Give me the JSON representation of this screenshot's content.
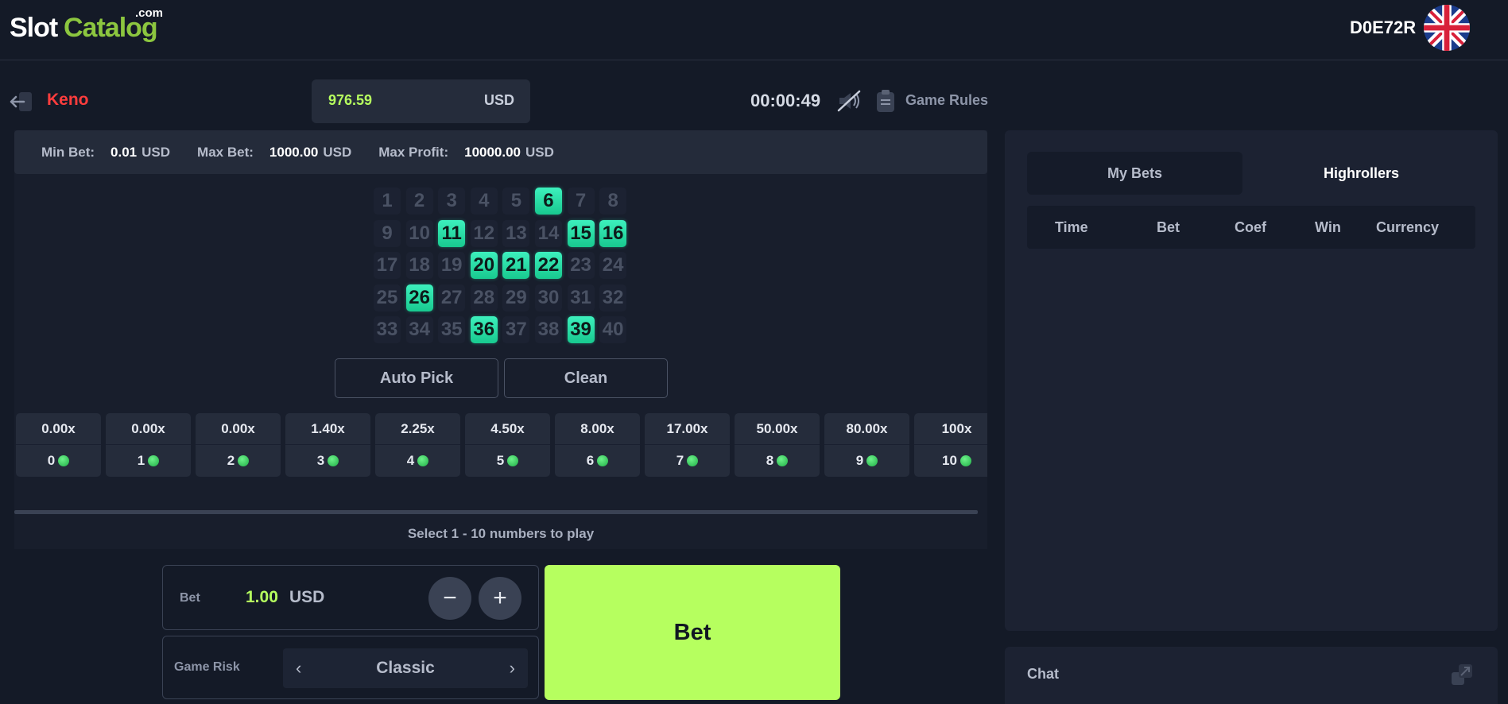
{
  "header": {
    "logo_part1": "Slot",
    "logo_part2": "Catalog",
    "logo_suffix": ".com",
    "username": "D0E72R"
  },
  "game": {
    "title": "Keno",
    "balance": "976.59",
    "balance_currency": "USD",
    "timer": "00:00:49",
    "rules_label": "Game Rules"
  },
  "limits": {
    "min_label": "Min Bet:",
    "min_value": "0.01",
    "min_currency": "USD",
    "max_label": "Max Bet:",
    "max_value": "1000.00",
    "max_currency": "USD",
    "profit_label": "Max Profit:",
    "profit_value": "10000.00",
    "profit_currency": "USD"
  },
  "grid": {
    "numbers": [
      1,
      2,
      3,
      4,
      5,
      6,
      7,
      8,
      9,
      10,
      11,
      12,
      13,
      14,
      15,
      16,
      17,
      18,
      19,
      20,
      21,
      22,
      23,
      24,
      25,
      26,
      27,
      28,
      29,
      30,
      31,
      32,
      33,
      34,
      35,
      36,
      37,
      38,
      39,
      40
    ],
    "selected": [
      6,
      11,
      15,
      16,
      20,
      21,
      22,
      26,
      36,
      39
    ]
  },
  "actions": {
    "auto_pick": "Auto Pick",
    "clean": "Clean"
  },
  "payouts": [
    {
      "mult": "0.00x",
      "hits": "0"
    },
    {
      "mult": "0.00x",
      "hits": "1"
    },
    {
      "mult": "0.00x",
      "hits": "2"
    },
    {
      "mult": "1.40x",
      "hits": "3"
    },
    {
      "mult": "2.25x",
      "hits": "4"
    },
    {
      "mult": "4.50x",
      "hits": "5"
    },
    {
      "mult": "8.00x",
      "hits": "6"
    },
    {
      "mult": "17.00x",
      "hits": "7"
    },
    {
      "mult": "50.00x",
      "hits": "8"
    },
    {
      "mult": "80.00x",
      "hits": "9"
    },
    {
      "mult": "100x",
      "hits": "10"
    }
  ],
  "hint": "Select 1 - 10 numbers to play",
  "bet": {
    "label": "Bet",
    "amount": "1.00",
    "currency": "USD",
    "minus": "−",
    "plus": "+",
    "button_label": "Bet"
  },
  "risk": {
    "label": "Game Risk",
    "value": "Classic",
    "prev": "‹",
    "next": "›"
  },
  "bets_panel": {
    "tabs": [
      "My Bets",
      "Highrollers"
    ],
    "columns": [
      "Time",
      "Bet",
      "Coef",
      "Win",
      "Currency"
    ]
  },
  "chat": {
    "label": "Chat"
  },
  "colors": {
    "accent_green": "#b6ff5f",
    "selected_cell": "#27dca5",
    "title_red": "#ff3d3d",
    "background": "#141a27"
  },
  "icons": {
    "back": "back-arrow-icon",
    "sound": "sound-muted-icon",
    "rules": "clipboard-icon",
    "flag": "uk-flag-icon",
    "chat_expand": "expand-icon"
  }
}
